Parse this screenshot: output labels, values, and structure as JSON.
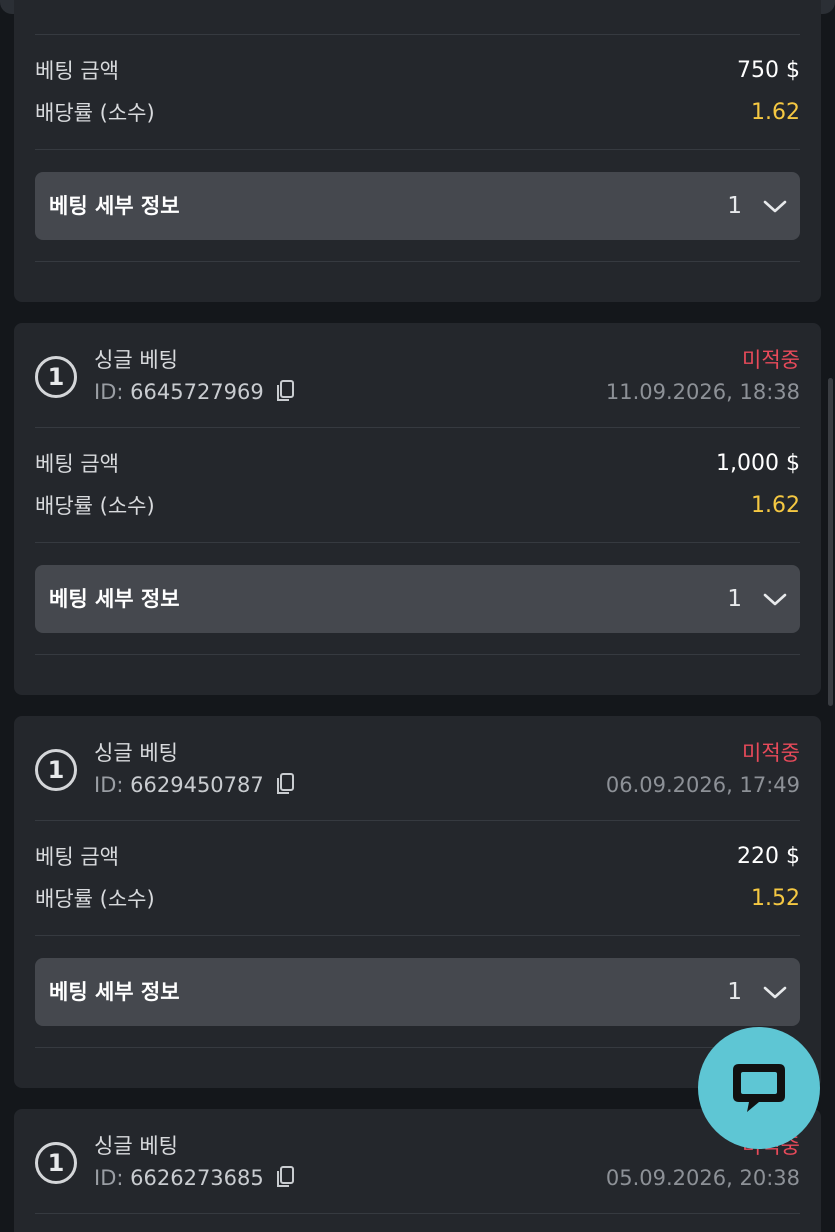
{
  "labels": {
    "amount": "베팅 금액",
    "odds": "배당률 (소수)",
    "details": "베팅 세부 정보",
    "bet_type": "싱글 베팅",
    "id_prefix": "ID:"
  },
  "bets": [
    {
      "amount": "750 $",
      "odds": "1.62",
      "selection_count": "1"
    },
    {
      "type": "싱글 베팅",
      "id": "6645727969",
      "status": "미적중",
      "datetime": "11.09.2026, 18:38",
      "amount": "1,000 $",
      "odds": "1.62",
      "selection_count": "1",
      "badge": "1"
    },
    {
      "type": "싱글 베팅",
      "id": "6629450787",
      "status": "미적중",
      "datetime": "06.09.2026, 17:49",
      "amount": "220 $",
      "odds": "1.52",
      "selection_count": "1",
      "badge": "1"
    },
    {
      "type": "싱글 베팅",
      "id": "6626273685",
      "status": "미적중",
      "datetime": "05.09.2026, 20:38",
      "badge": "1"
    }
  ],
  "colors": {
    "background": "#14171b",
    "card": "#24272c",
    "details_bg": "#45484e",
    "odds": "#f5c842",
    "status_lost": "#e84a5a",
    "chat_button": "#5ec6d4"
  },
  "icons": {
    "copy": "copy-icon",
    "chevron": "chevron-down-icon",
    "chat": "chat-bubble-icon"
  }
}
